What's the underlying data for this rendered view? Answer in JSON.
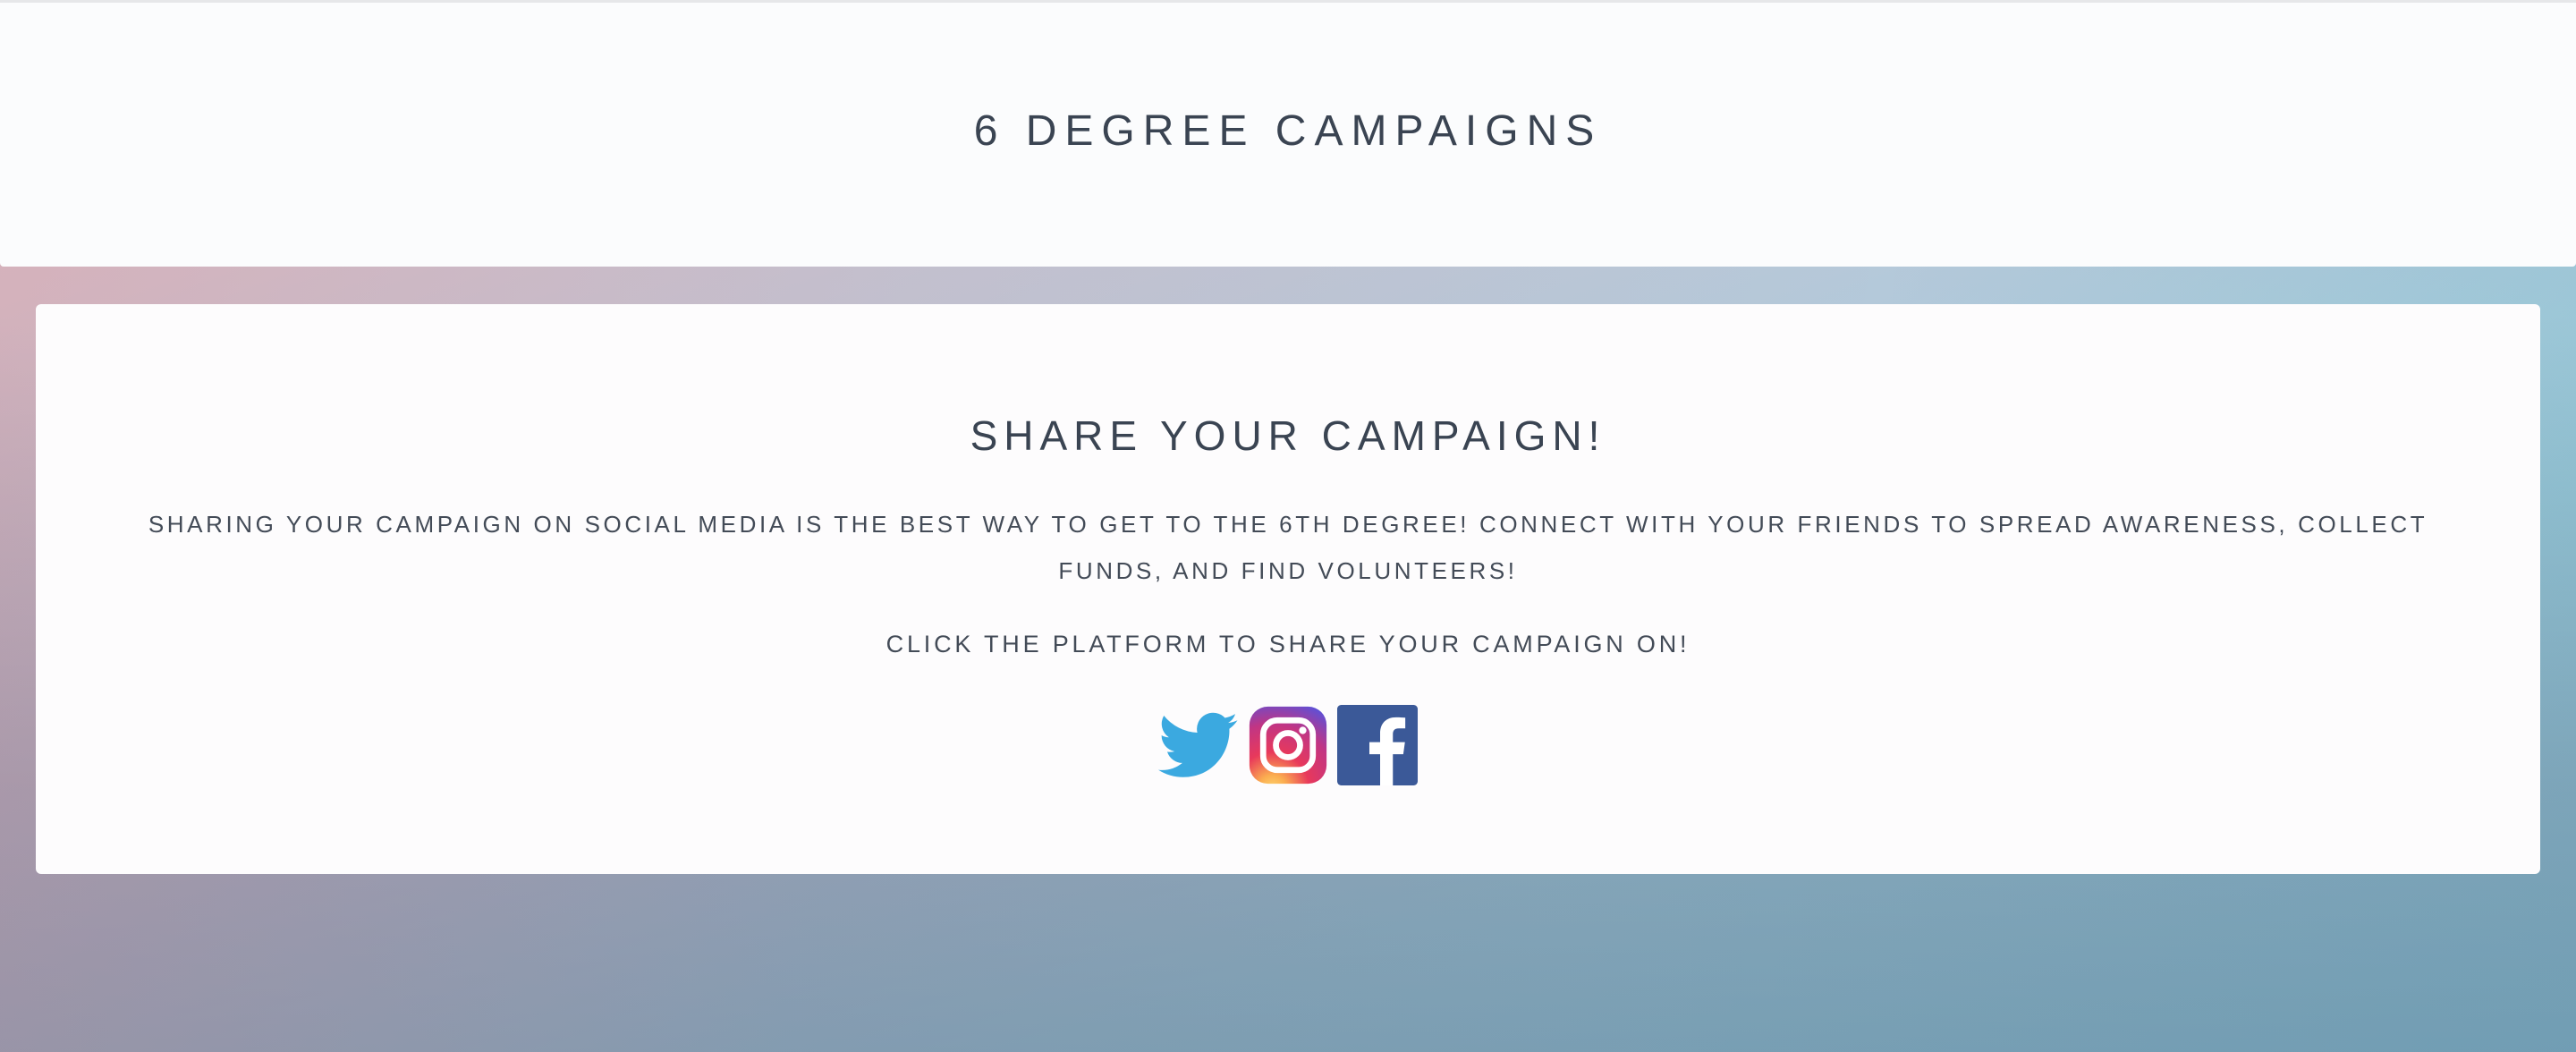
{
  "header": {
    "title": "6 DEGREE CAMPAIGNS"
  },
  "share": {
    "title": "SHARE YOUR CAMPAIGN!",
    "description": "SHARING YOUR CAMPAIGN ON SOCIAL MEDIA IS THE BEST WAY TO GET TO THE 6TH DEGREE! CONNECT WITH YOUR FRIENDS TO SPREAD AWARENESS, COLLECT FUNDS, AND FIND VOLUNTEERS!",
    "prompt": "CLICK THE PLATFORM TO SHARE YOUR CAMPAIGN ON!",
    "platforms": [
      {
        "name": "twitter-icon",
        "color": "#3ba9e0"
      },
      {
        "name": "instagram-icon",
        "color": "#c13584"
      },
      {
        "name": "facebook-icon",
        "color": "#3b5998"
      }
    ]
  }
}
